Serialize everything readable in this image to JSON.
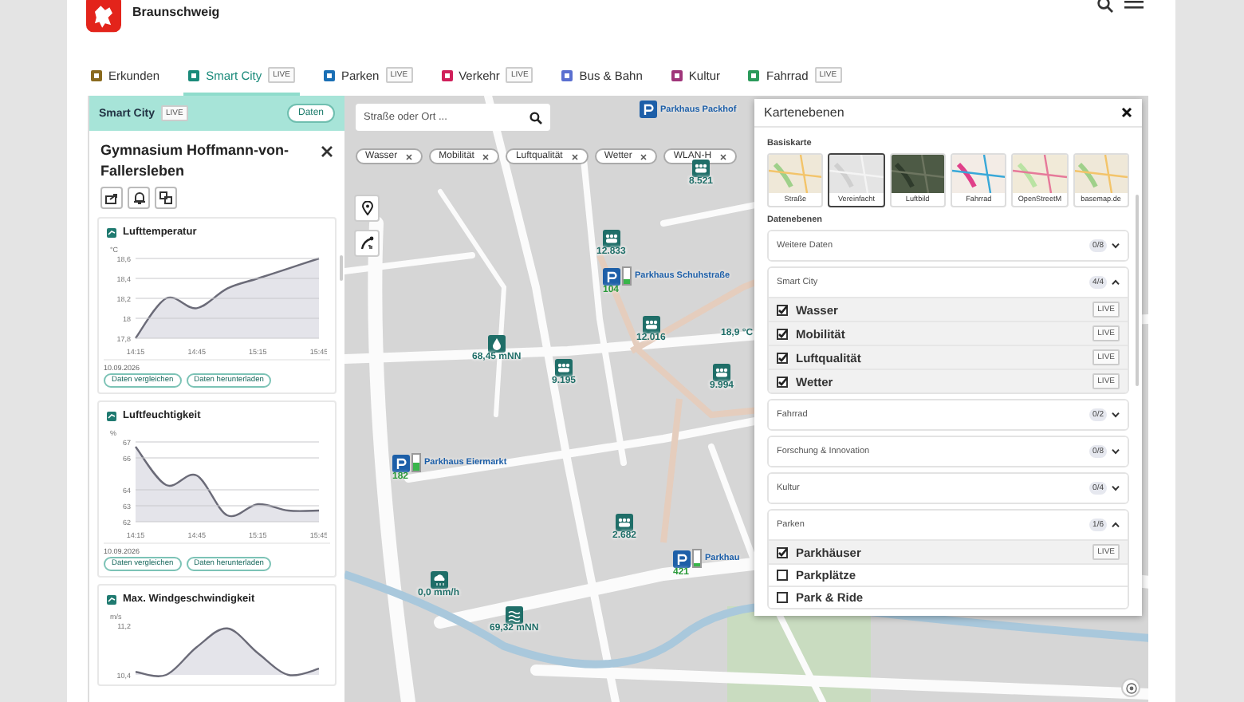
{
  "header": {
    "city": "Braunschweig"
  },
  "tabs": [
    {
      "label": "Erkunden",
      "selected": false,
      "color": "#8a6a1e"
    },
    {
      "label": "Smart City",
      "selected": true,
      "color": "#1a8a7a",
      "badge": "LIVE"
    },
    {
      "label": "Parken",
      "selected": false,
      "color": "#1a6fb5",
      "badge": "LIVE"
    },
    {
      "label": "Verkehr",
      "selected": false,
      "color": "#d01f5a",
      "badge": "LIVE"
    },
    {
      "label": "Bus & Bahn",
      "selected": false,
      "color": "#5a6fd0"
    },
    {
      "label": "Kultur",
      "selected": false,
      "color": "#a0357a"
    },
    {
      "label": "Fahrrad",
      "selected": false,
      "color": "#2a9a5a",
      "badge": "LIVE"
    }
  ],
  "sidebar": {
    "title": "Smart City",
    "badge": "LIVE",
    "data_button": "Daten",
    "station": "Gymnasium Hoffmann-von-Fallersleben",
    "cards": [
      {
        "title": "Lufttemperatur",
        "date": "10.09.2026",
        "buttons": [
          "Daten vergleichen",
          "Daten herunterladen"
        ],
        "chart_data": {
          "type": "area",
          "grid": true,
          "ylabel": "°C",
          "categories": [
            "14:15",
            null,
            "14:45",
            null,
            "15:15",
            null,
            "15:45"
          ],
          "ylim": [
            17.8,
            18.6
          ],
          "yticks": [
            {
              "value": 17.8,
              "label": "17,8"
            },
            {
              "value": 18,
              "label": "18"
            },
            {
              "value": 18.2,
              "label": "18,2"
            },
            {
              "value": 18.4,
              "label": "18,4"
            },
            {
              "value": 18.6,
              "label": "18,6"
            }
          ],
          "series": [
            {
              "color": "#6b6b78",
              "values": [
                17.8,
                18.2,
                18.1,
                18.3,
                18.4,
                18.5,
                18.6
              ]
            }
          ]
        }
      },
      {
        "title": "Luftfeuchtigkeit",
        "date": "10.09.2026",
        "buttons": [
          "Daten vergleichen",
          "Daten herunterladen"
        ],
        "chart_data": {
          "type": "area",
          "grid": true,
          "ylabel": "%",
          "categories": [
            "14:15",
            null,
            "14:45",
            null,
            "15:15",
            null,
            "15:45"
          ],
          "ylim": [
            62,
            67
          ],
          "yticks": [
            62,
            63,
            64,
            66,
            67
          ],
          "series": [
            {
              "color": "#6b6b78",
              "values": [
                66.7,
                64.3,
                64.9,
                62.4,
                63.1,
                62.7,
                62.7
              ]
            }
          ]
        }
      },
      {
        "title": "Max. Windgeschwindigkeit",
        "chart_data": {
          "type": "area",
          "ylabel": "m/s",
          "categories": [
            null,
            null,
            null,
            null,
            null,
            null,
            null
          ],
          "ylim": [
            10.4,
            11.2
          ],
          "yticks": [
            {
              "value": 10.4,
              "label": "10,4"
            },
            {
              "value": 11.2,
              "label": "11,2"
            }
          ],
          "series": [
            {
              "color": "#6b6b78",
              "values": [
                10.45,
                10.4,
                10.85,
                11.15,
                10.75,
                10.4,
                10.5
              ]
            }
          ]
        }
      }
    ]
  },
  "map": {
    "search": {
      "placeholder": "Straße oder Ort ..."
    },
    "filters": [
      "Wasser",
      "Mobilität",
      "Luftqualität",
      "Wetter",
      "WLAN-H"
    ],
    "markers": [
      {
        "kind": "parking",
        "name": "Parkhaus Packhof"
      },
      {
        "kind": "counter",
        "value": "8.521"
      },
      {
        "kind": "counter",
        "value": "12.833"
      },
      {
        "kind": "parking",
        "name": "Parkhaus Schuhstraße",
        "count": "104",
        "level": 0.35
      },
      {
        "kind": "counter",
        "value": "12.016"
      },
      {
        "kind": "reading",
        "value": "18,9 °C"
      },
      {
        "kind": "water",
        "value": "68,45 mNN"
      },
      {
        "kind": "counter",
        "value": "9.195"
      },
      {
        "kind": "counter",
        "value": "9.994"
      },
      {
        "kind": "parking",
        "name": "Parkhaus Eiermarkt",
        "count": "182",
        "level": 0.55
      },
      {
        "kind": "counter",
        "value": "2.682"
      },
      {
        "kind": "parking",
        "name": "Parkhau",
        "count": "421",
        "level": 0.25
      },
      {
        "kind": "rain",
        "value": "0,0 mm/h"
      },
      {
        "kind": "gauge",
        "value": "69,32 mNN"
      }
    ]
  },
  "layers_panel": {
    "title": "Kartenebenen",
    "basemap_label": "Basiskarte",
    "basemaps": [
      {
        "label": "Straße",
        "kind": "street",
        "selected": false
      },
      {
        "label": "Vereinfacht",
        "kind": "simple",
        "selected": true
      },
      {
        "label": "Luftbild",
        "kind": "aerial",
        "selected": false
      },
      {
        "label": "Fahrrad",
        "kind": "bike",
        "selected": false
      },
      {
        "label": "OpenStreetM",
        "kind": "osm",
        "selected": false
      },
      {
        "label": "basemap.de",
        "kind": "street",
        "selected": false
      }
    ],
    "data_label": "Datenebenen",
    "groups": [
      {
        "name": "Weitere Daten",
        "count": "0/8",
        "expanded": false
      },
      {
        "name": "Smart City",
        "count": "4/4",
        "expanded": true,
        "items": [
          {
            "label": "Wasser",
            "checked": true,
            "badge": "LIVE"
          },
          {
            "label": "Mobilität",
            "checked": true,
            "badge": "LIVE"
          },
          {
            "label": "Luftqualität",
            "checked": true,
            "badge": "LIVE"
          },
          {
            "label": "Wetter",
            "checked": true,
            "badge": "LIVE"
          }
        ]
      },
      {
        "name": "Fahrrad",
        "count": "0/2",
        "expanded": false
      },
      {
        "name": "Forschung & Innovation",
        "count": "0/8",
        "expanded": false
      },
      {
        "name": "Kultur",
        "count": "0/4",
        "expanded": false
      },
      {
        "name": "Parken",
        "count": "1/6",
        "expanded": true,
        "items": [
          {
            "label": "Parkhäuser",
            "checked": true,
            "badge": "LIVE"
          },
          {
            "label": "Parkplätze",
            "checked": false
          },
          {
            "label": "Park & Ride",
            "checked": false
          }
        ]
      }
    ]
  }
}
